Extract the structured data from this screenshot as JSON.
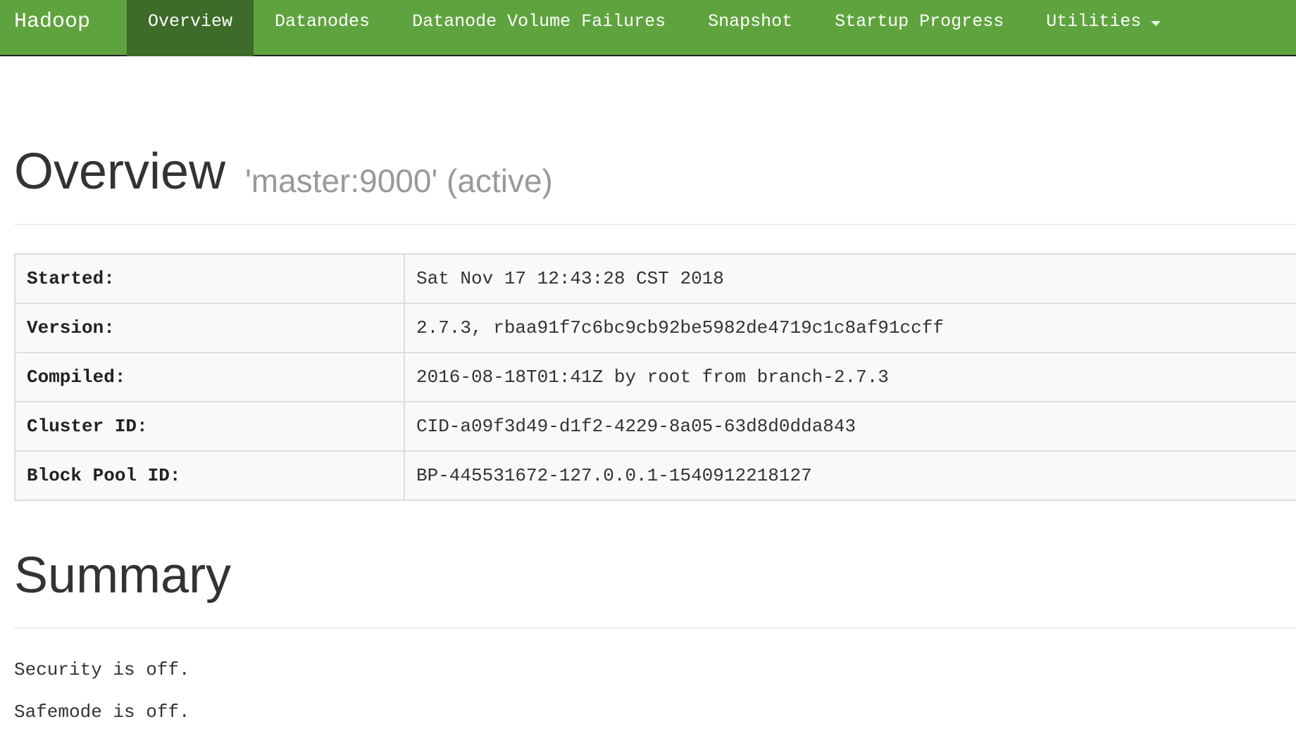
{
  "navbar": {
    "brand": "Hadoop",
    "items": [
      {
        "label": "Overview",
        "active": true
      },
      {
        "label": "Datanodes",
        "active": false
      },
      {
        "label": "Datanode Volume Failures",
        "active": false
      },
      {
        "label": "Snapshot",
        "active": false
      },
      {
        "label": "Startup Progress",
        "active": false
      },
      {
        "label": "Utilities",
        "active": false,
        "has_dropdown": true
      }
    ],
    "colors": {
      "background": "#5fa33e",
      "active_background": "#3d6b2a",
      "text": "#ffffff"
    }
  },
  "overview": {
    "title": "Overview",
    "subtitle": "'master:9000' (active)",
    "rows": [
      {
        "key": "Started:",
        "value": "Sat Nov 17 12:43:28 CST 2018"
      },
      {
        "key": "Version:",
        "value": "2.7.3, rbaa91f7c6bc9cb92be5982de4719c1c8af91ccff"
      },
      {
        "key": "Compiled:",
        "value": "2016-08-18T01:41Z by root from branch-2.7.3"
      },
      {
        "key": "Cluster ID:",
        "value": "CID-a09f3d49-d1f2-4229-8a05-63d8d0dda843"
      },
      {
        "key": "Block Pool ID:",
        "value": "BP-445531672-127.0.0.1-1540912218127"
      }
    ]
  },
  "summary": {
    "title": "Summary",
    "security": "Security is off.",
    "safemode": "Safemode is off."
  }
}
